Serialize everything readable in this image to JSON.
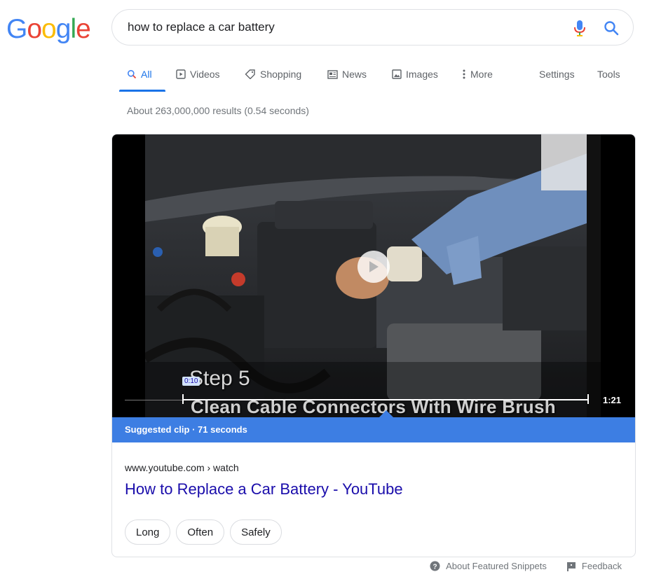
{
  "logo": {
    "text": "Google",
    "letters": [
      "G",
      "o",
      "o",
      "g",
      "l",
      "e"
    ],
    "colors": [
      "#4285f4",
      "#ea4335",
      "#fbbc05",
      "#4285f4",
      "#34a853",
      "#ea4335"
    ]
  },
  "search": {
    "query": "how to replace a car battery"
  },
  "tabs": [
    {
      "label": "All",
      "icon": "search-icon"
    },
    {
      "label": "Videos",
      "icon": "video-icon"
    },
    {
      "label": "Shopping",
      "icon": "tag-icon"
    },
    {
      "label": "News",
      "icon": "newspaper-icon"
    },
    {
      "label": "Images",
      "icon": "image-icon"
    },
    {
      "label": "More",
      "icon": "more-vertical-icon"
    },
    {
      "label": "Settings"
    },
    {
      "label": "Tools"
    }
  ],
  "result_stats": "About 263,000,000 results (0.54 seconds)",
  "video": {
    "step_title": "Step 5",
    "step_caption": "Clean Cable Connectors With Wire Brush",
    "clip_start": "0:10",
    "duration": "1:21"
  },
  "suggested_clip": "Suggested clip · 71 seconds",
  "result": {
    "url": "www.youtube.com › watch",
    "title": "How to Replace a Car Battery - YouTube"
  },
  "chips": [
    "Long",
    "Often",
    "Safely"
  ],
  "footer": {
    "about_label": "About Featured Snippets",
    "feedback_label": "Feedback"
  },
  "colors": {
    "accent": "#1a73e8",
    "link": "#1a0dab",
    "clip_bar": "#3d7ee3"
  }
}
